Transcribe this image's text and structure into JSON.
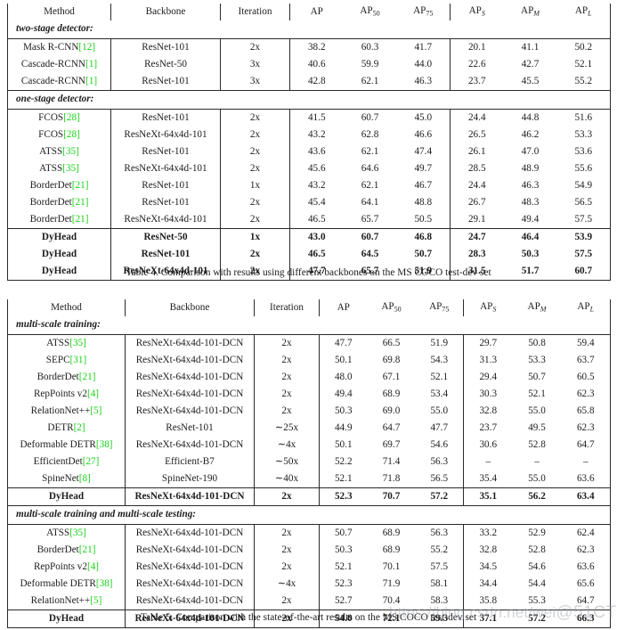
{
  "document": {
    "type": "research-paper-tables",
    "watermark": {
      "url_text": "https://blog.csdn.net/wei",
      "handle_text": "@51CTO博客"
    }
  },
  "table4": {
    "caption": "Table 4. Comparison with results using different backbones on the MS COCO test-dev set",
    "columns": [
      "Method",
      "Backbone",
      "Iteration",
      "AP",
      "AP50",
      "AP75",
      "APS",
      "APM",
      "APL"
    ],
    "headers": [
      {
        "label": "Method"
      },
      {
        "label": "Backbone"
      },
      {
        "label": "Iteration"
      },
      {
        "label": "AP",
        "sub": ""
      },
      {
        "label": "AP",
        "sub": "50"
      },
      {
        "label": "AP",
        "sub": "75"
      },
      {
        "label": "AP",
        "sub": "S",
        "italic": true
      },
      {
        "label": "AP",
        "sub": "M",
        "italic": true
      },
      {
        "label": "AP",
        "sub": "L",
        "italic": true
      }
    ],
    "groups": [
      {
        "title": "two-stage detector:",
        "rows": [
          {
            "method": "Mask R-CNN",
            "cite": "12",
            "backbone": "ResNet-101",
            "iteration": "2x",
            "ap": "38.2",
            "ap50": "60.3",
            "ap75": "41.7",
            "aps": "20.1",
            "apm": "41.1",
            "apl": "50.2",
            "bold": false
          },
          {
            "method": "Cascade-RCNN",
            "cite": "1",
            "backbone": "ResNet-50",
            "iteration": "3x",
            "ap": "40.6",
            "ap50": "59.9",
            "ap75": "44.0",
            "aps": "22.6",
            "apm": "42.7",
            "apl": "52.1",
            "bold": false
          },
          {
            "method": "Cascade-RCNN",
            "cite": "1",
            "backbone": "ResNet-101",
            "iteration": "3x",
            "ap": "42.8",
            "ap50": "62.1",
            "ap75": "46.3",
            "aps": "23.7",
            "apm": "45.5",
            "apl": "55.2",
            "bold": false
          }
        ]
      },
      {
        "title": "one-stage detector:",
        "rows": [
          {
            "method": "FCOS",
            "cite": "28",
            "backbone": "ResNet-101",
            "iteration": "2x",
            "ap": "41.5",
            "ap50": "60.7",
            "ap75": "45.0",
            "aps": "24.4",
            "apm": "44.8",
            "apl": "51.6",
            "bold": false
          },
          {
            "method": "FCOS",
            "cite": "28",
            "backbone": "ResNeXt-64x4d-101",
            "iteration": "2x",
            "ap": "43.2",
            "ap50": "62.8",
            "ap75": "46.6",
            "aps": "26.5",
            "apm": "46.2",
            "apl": "53.3",
            "bold": false
          },
          {
            "method": "ATSS",
            "cite": "35",
            "backbone": "ResNet-101",
            "iteration": "2x",
            "ap": "43.6",
            "ap50": "62.1",
            "ap75": "47.4",
            "aps": "26.1",
            "apm": "47.0",
            "apl": "53.6",
            "bold": false
          },
          {
            "method": "ATSS",
            "cite": "35",
            "backbone": "ResNeXt-64x4d-101",
            "iteration": "2x",
            "ap": "45.6",
            "ap50": "64.6",
            "ap75": "49.7",
            "aps": "28.5",
            "apm": "48.9",
            "apl": "55.6",
            "bold": false
          },
          {
            "method": "BorderDet",
            "cite": "21",
            "backbone": "ResNet-101",
            "iteration": "1x",
            "ap": "43.2",
            "ap50": "62.1",
            "ap75": "46.7",
            "aps": "24.4",
            "apm": "46.3",
            "apl": "54.9",
            "bold": false
          },
          {
            "method": "BorderDet",
            "cite": "21",
            "backbone": "ResNet-101",
            "iteration": "2x",
            "ap": "45.4",
            "ap50": "64.1",
            "ap75": "48.8",
            "aps": "26.7",
            "apm": "48.3",
            "apl": "56.5",
            "bold": false
          },
          {
            "method": "BorderDet",
            "cite": "21",
            "backbone": "ResNeXt-64x4d-101",
            "iteration": "2x",
            "ap": "46.5",
            "ap50": "65.7",
            "ap75": "50.5",
            "aps": "29.1",
            "apm": "49.4",
            "apl": "57.5",
            "bold": false
          }
        ]
      },
      {
        "title": "",
        "rows": [
          {
            "method": "DyHead",
            "cite": "",
            "backbone": "ResNet-50",
            "iteration": "1x",
            "ap": "43.0",
            "ap50": "60.7",
            "ap75": "46.8",
            "aps": "24.7",
            "apm": "46.4",
            "apl": "53.9",
            "bold": true
          },
          {
            "method": "DyHead",
            "cite": "",
            "backbone": "ResNet-101",
            "iteration": "2x",
            "ap": "46.5",
            "ap50": "64.5",
            "ap75": "50.7",
            "aps": "28.3",
            "apm": "50.3",
            "apl": "57.5",
            "bold": true
          },
          {
            "method": "DyHead",
            "cite": "",
            "backbone": "ResNeXt-64x4d-101",
            "iteration": "2x",
            "ap": "47.7",
            "ap50": "65.7",
            "ap75": "51.9",
            "aps": "31.5",
            "apm": "51.7",
            "apl": "60.7",
            "bold": true
          }
        ]
      }
    ]
  },
  "table5": {
    "caption": "Table 5. Comparison with the state-of-the-art results on the MS COCO test-dev set",
    "columns": [
      "Method",
      "Backbone",
      "Iteration",
      "AP",
      "AP50",
      "AP75",
      "APS",
      "APM",
      "APL"
    ],
    "headers": [
      {
        "label": "Method"
      },
      {
        "label": "Backbone"
      },
      {
        "label": "Iteration"
      },
      {
        "label": "AP",
        "sub": ""
      },
      {
        "label": "AP",
        "sub": "50"
      },
      {
        "label": "AP",
        "sub": "75"
      },
      {
        "label": "AP",
        "sub": "S",
        "italic": true
      },
      {
        "label": "AP",
        "sub": "M",
        "italic": true
      },
      {
        "label": "AP",
        "sub": "L",
        "italic": true
      }
    ],
    "groups": [
      {
        "title": "multi-scale training:",
        "rows": [
          {
            "method": "ATSS",
            "cite": "35",
            "backbone": "ResNeXt-64x4d-101-DCN",
            "iteration": "2x",
            "ap": "47.7",
            "ap50": "66.5",
            "ap75": "51.9",
            "aps": "29.7",
            "apm": "50.8",
            "apl": "59.4",
            "bold": false
          },
          {
            "method": "SEPC",
            "cite": "31",
            "backbone": "ResNeXt-64x4d-101-DCN",
            "iteration": "2x",
            "ap": "50.1",
            "ap50": "69.8",
            "ap75": "54.3",
            "aps": "31.3",
            "apm": "53.3",
            "apl": "63.7",
            "bold": false
          },
          {
            "method": "BorderDet",
            "cite": "21",
            "backbone": "ResNeXt-64x4d-101-DCN",
            "iteration": "2x",
            "ap": "48.0",
            "ap50": "67.1",
            "ap75": "52.1",
            "aps": "29.4",
            "apm": "50.7",
            "apl": "60.5",
            "bold": false
          },
          {
            "method": "RepPoints v2",
            "cite": "4",
            "backbone": "ResNeXt-64x4d-101-DCN",
            "iteration": "2x",
            "ap": "49.4",
            "ap50": "68.9",
            "ap75": "53.4",
            "aps": "30.3",
            "apm": "52.1",
            "apl": "62.3",
            "bold": false
          },
          {
            "method": "RelationNet++",
            "cite": "5",
            "backbone": "ResNeXt-64x4d-101-DCN",
            "iteration": "2x",
            "ap": "50.3",
            "ap50": "69.0",
            "ap75": "55.0",
            "aps": "32.8",
            "apm": "55.0",
            "apl": "65.8",
            "bold": false
          },
          {
            "method": "DETR",
            "cite": "2",
            "backbone": "ResNet-101",
            "iteration": "∼25x",
            "ap": "44.9",
            "ap50": "64.7",
            "ap75": "47.7",
            "aps": "23.7",
            "apm": "49.5",
            "apl": "62.3",
            "bold": false
          },
          {
            "method": "Deformable DETR",
            "cite": "38",
            "backbone": "ResNeXt-64x4d-101-DCN",
            "iteration": "∼4x",
            "ap": "50.1",
            "ap50": "69.7",
            "ap75": "54.6",
            "aps": "30.6",
            "apm": "52.8",
            "apl": "64.7",
            "bold": false
          },
          {
            "method": "EfficientDet",
            "cite": "27",
            "backbone": "Efficient-B7",
            "iteration": "∼50x",
            "ap": "52.2",
            "ap50": "71.4",
            "ap75": "56.3",
            "aps": "–",
            "apm": "–",
            "apl": "–",
            "bold": false
          },
          {
            "method": "SpineNet",
            "cite": "8",
            "backbone": "SpineNet-190",
            "iteration": "∼40x",
            "ap": "52.1",
            "ap50": "71.8",
            "ap75": "56.5",
            "aps": "35.4",
            "apm": "55.0",
            "apl": "63.6",
            "bold": false
          }
        ]
      },
      {
        "title": "",
        "rows": [
          {
            "method": "DyHead",
            "cite": "",
            "backbone": "ResNeXt-64x4d-101-DCN",
            "iteration": "2x",
            "ap": "52.3",
            "ap50": "70.7",
            "ap75": "57.2",
            "aps": "35.1",
            "apm": "56.2",
            "apl": "63.4",
            "bold": true
          }
        ]
      },
      {
        "title": "multi-scale training and multi-scale testing:",
        "rows": [
          {
            "method": "ATSS",
            "cite": "35",
            "backbone": "ResNeXt-64x4d-101-DCN",
            "iteration": "2x",
            "ap": "50.7",
            "ap50": "68.9",
            "ap75": "56.3",
            "aps": "33.2",
            "apm": "52.9",
            "apl": "62.4",
            "bold": false
          },
          {
            "method": "BorderDet",
            "cite": "21",
            "backbone": "ResNeXt-64x4d-101-DCN",
            "iteration": "2x",
            "ap": "50.3",
            "ap50": "68.9",
            "ap75": "55.2",
            "aps": "32.8",
            "apm": "52.8",
            "apl": "62.3",
            "bold": false
          },
          {
            "method": "RepPoints v2",
            "cite": "4",
            "backbone": "ResNeXt-64x4d-101-DCN",
            "iteration": "2x",
            "ap": "52.1",
            "ap50": "70.1",
            "ap75": "57.5",
            "aps": "34.5",
            "apm": "54.6",
            "apl": "63.6",
            "bold": false
          },
          {
            "method": "Deformable DETR",
            "cite": "38",
            "backbone": "ResNeXt-64x4d-101-DCN",
            "iteration": "∼4x",
            "ap": "52.3",
            "ap50": "71.9",
            "ap75": "58.1",
            "aps": "34.4",
            "apm": "54.4",
            "apl": "65.6",
            "bold": false
          },
          {
            "method": "RelationNet++",
            "cite": "5",
            "backbone": "ResNeXt-64x4d-101-DCN",
            "iteration": "2x",
            "ap": "52.7",
            "ap50": "70.4",
            "ap75": "58.3",
            "aps": "35.8",
            "apm": "55.3",
            "apl": "64.7",
            "bold": false
          }
        ]
      },
      {
        "title": "",
        "rows": [
          {
            "method": "DyHead",
            "cite": "",
            "backbone": "ResNeXt-64x4d-101-DCN",
            "iteration": "2x",
            "ap": "54.0",
            "ap50": "72.1",
            "ap75": "59.3",
            "aps": "37.1",
            "apm": "57.2",
            "apl": "66.3",
            "bold": true
          }
        ]
      }
    ]
  }
}
